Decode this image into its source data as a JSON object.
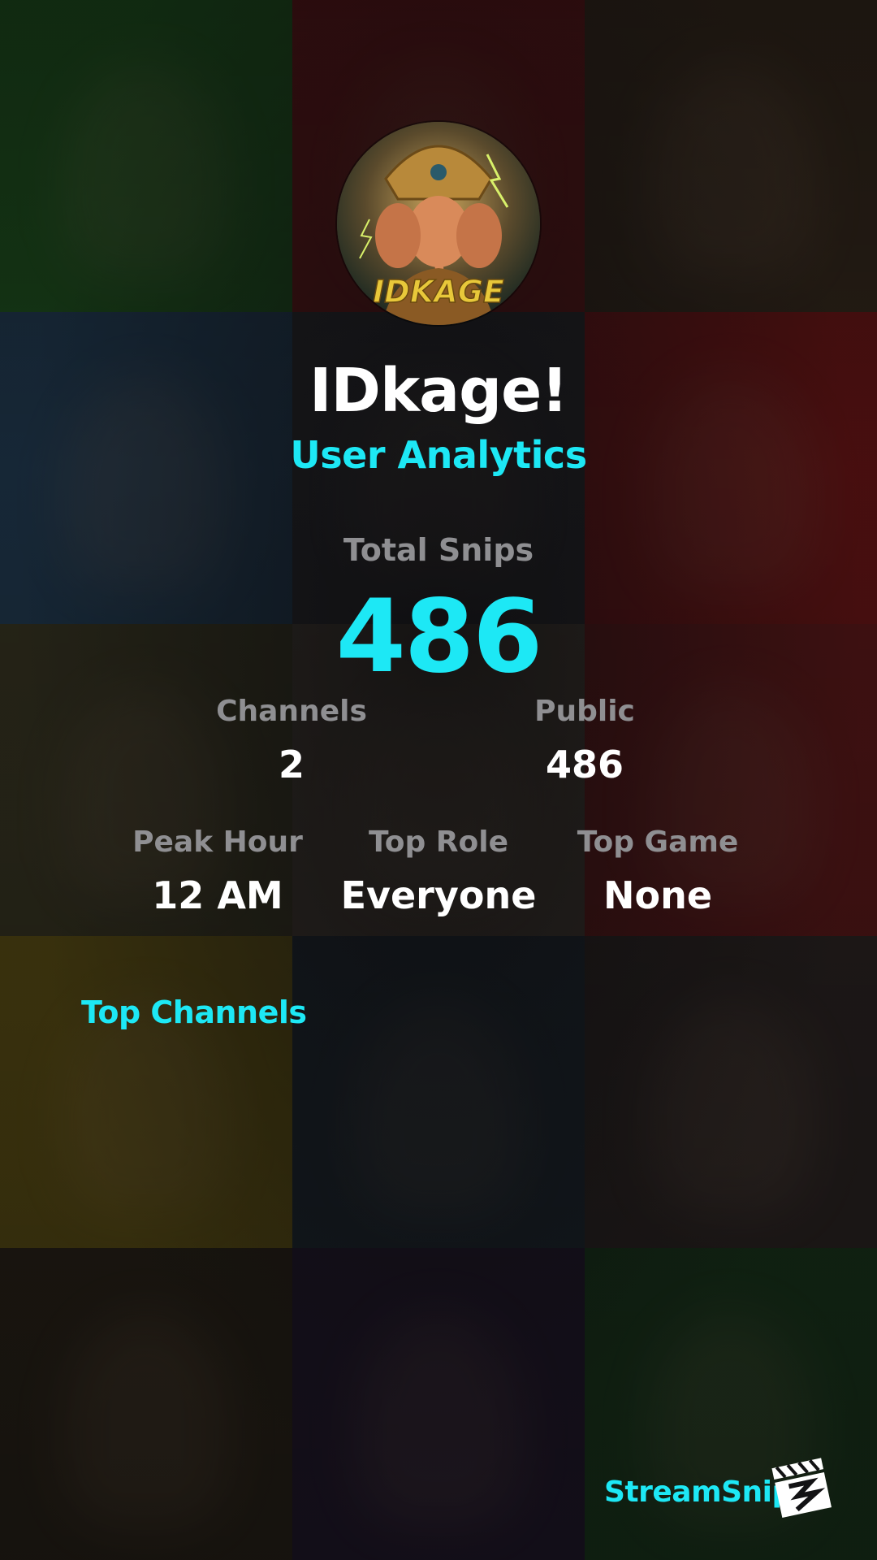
{
  "profile": {
    "username": "IDkage!",
    "subtitle": "User Analytics",
    "avatar_text": "IDKAGE"
  },
  "total": {
    "label": "Total Snips",
    "value": "486"
  },
  "stats_row1": [
    {
      "label": "Channels",
      "value": "2"
    },
    {
      "label": "Public",
      "value": "486"
    }
  ],
  "stats_row2": [
    {
      "label": "Peak Hour",
      "value": "12 AM"
    },
    {
      "label": "Top Role",
      "value": "Everyone"
    },
    {
      "label": "Top Game",
      "value": "None"
    }
  ],
  "top_channels": {
    "heading": "Top Channels"
  },
  "brand": {
    "name": "StreamSnip",
    "icon": "clapperboard-icon"
  },
  "colors": {
    "accent": "#1de8f5",
    "label": "#8f8f92",
    "value": "#ffffff",
    "background": "#121214"
  }
}
